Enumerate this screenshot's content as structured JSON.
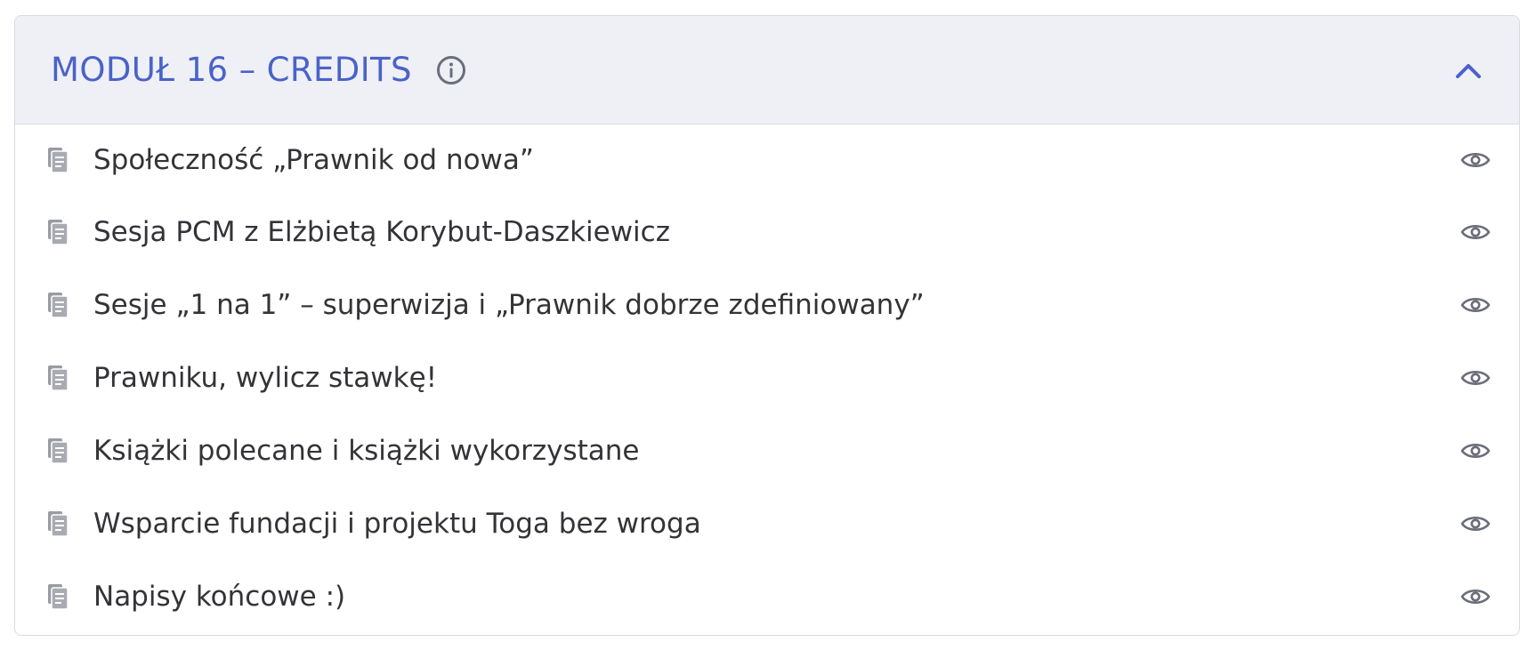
{
  "module": {
    "title": "MODUŁ 16 – CREDITS",
    "accent_color": "#4a62c9",
    "header_background": "#eff0f6",
    "info_icon": "info-circle-icon",
    "toggle_icon": "chevron-up-icon",
    "lessons": [
      {
        "title": "Społeczność „Prawnik od nowa”",
        "icon": "document-icon",
        "action_icon": "eye-icon"
      },
      {
        "title": "Sesja PCM z Elżbietą Korybut-Daszkiewicz",
        "icon": "document-icon",
        "action_icon": "eye-icon"
      },
      {
        "title": "Sesje „1 na 1” – superwizja i „Prawnik dobrze zdefiniowany”",
        "icon": "document-icon",
        "action_icon": "eye-icon"
      },
      {
        "title": "Prawniku, wylicz stawkę!",
        "icon": "document-icon",
        "action_icon": "eye-icon"
      },
      {
        "title": "Książki polecane i książki wykorzystane",
        "icon": "document-icon",
        "action_icon": "eye-icon"
      },
      {
        "title": "Wsparcie fundacji i projektu Toga bez wroga",
        "icon": "document-icon",
        "action_icon": "eye-icon"
      },
      {
        "title": "Napisy końcowe :)",
        "icon": "document-icon",
        "action_icon": "eye-icon"
      }
    ]
  }
}
